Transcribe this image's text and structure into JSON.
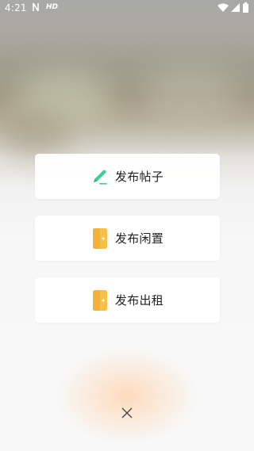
{
  "status_bar": {
    "time": "4:21",
    "notification_icon": "n-icon",
    "hd_icon": "hd-icon",
    "hd_label": "HD"
  },
  "actions": [
    {
      "label": "发布帖子",
      "icon": "pencil-icon",
      "icon_color": "#3ccf8e"
    },
    {
      "label": "发布闲置",
      "icon": "door-icon",
      "icon_color": "#f5c04a"
    },
    {
      "label": "发布出租",
      "icon": "door-icon",
      "icon_color": "#f5c04a"
    }
  ],
  "close": {
    "icon": "close-icon"
  }
}
